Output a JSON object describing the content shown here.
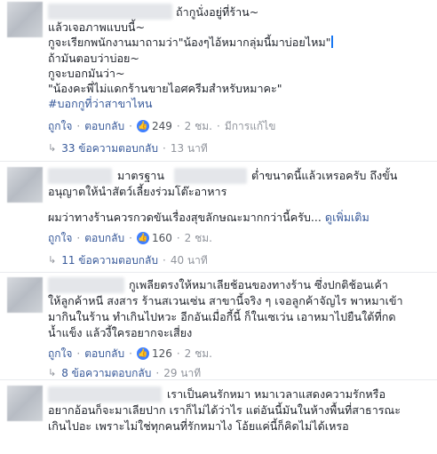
{
  "comments": [
    {
      "lines": [
        "ถ้ากูนั่งอยู่ที่ร้าน~",
        "แล้วเจอภาพแบบนี้~",
        "กูจะเรียกพนักงานมาถามว่า\"น้องๆไอ้หมากลุ่มนี้มาบ่อยไหม\"",
        "ถ้ามันตอบว่าบ่อย~",
        "กูจะบอกมันว่า~",
        "\"น้องคะพี่ไม่แดกร้านขายไอศครีมสำหรับหมาคะ\""
      ],
      "hashtag": "#บอกกูที่ว่าสาขาไหน",
      "actions": {
        "like": "ถูกใจ",
        "reply": "ตอบกลับ",
        "likes": "249",
        "time": "2 ชม.",
        "edited": "มีการแก้ไข"
      },
      "replies": {
        "label": "33 ข้อความตอบกลับ",
        "time": "13 นาที"
      }
    },
    {
      "lines": [
        "มาตรฐาน",
        "ต่ำขนาดนี้แล้วเหรอครับ ถึงขั้น",
        "อนุญาตให้นำสัตว์เลี้ยงร่วมโต๊ะอาหาร",
        "ผมว่าทางร้านควรกวดขันเรื่องสุขลักษณะมากกว่านี้ครับ...",
        "ดูเพิ่มเติม"
      ],
      "actions": {
        "like": "ถูกใจ",
        "reply": "ตอบกลับ",
        "likes": "160",
        "time": "2 ชม."
      },
      "replies": {
        "label": "11 ข้อความตอบกลับ",
        "time": "40 นาที"
      }
    },
    {
      "lines": [
        "กูเพลียตรงให้หมาเลียช้อนของทางร้าน ซึ่งปกติช้อนเค้า",
        "ให้ลูกค้าหนี สงสาร ร้านสเวนเซ่น สาขานี้จริง ๆ เจอลูกค้าจัญไร พาหมาเข้า",
        "มากินในร้าน ทำเกินไปหวะ อีกอันเมื่อกี้นี้ ก็ในเซเว่น เอาหมาไปยืนใต้ที่กด",
        "น้ำแข็ง แล้วงี้ใครอยากจะเสี่ยง"
      ],
      "actions": {
        "like": "ถูกใจ",
        "reply": "ตอบกลับ",
        "likes": "126",
        "time": "2 ชม."
      },
      "replies": {
        "label": "8 ข้อความตอบกลับ",
        "time": "29 นาที"
      }
    },
    {
      "lines": [
        "เราเป็นคนรักหมา หมาเวลาแสดงความรักหรือ",
        "อยากอ้อนก็จะมาเลียปาก เราก็ไม่ได้ว่าไร แต่อันนี้มันในห้างพื้นที่สาธารณะ",
        "เกินไปอะ เพราะไม่ใช่ทุกคนที่รักหมาไง โอ้ยแค่นี้ก็คิดไม่ได้เหรอ"
      ]
    }
  ],
  "colors": {
    "link": "#365899",
    "muted": "#90949c",
    "like_blue": "#4080ff"
  },
  "icons": {
    "like": "thumbs-up-icon",
    "reply_arrow": "reply-arrow-icon"
  }
}
